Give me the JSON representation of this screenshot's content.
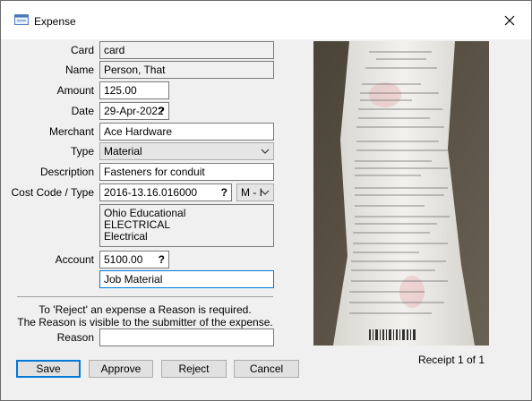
{
  "window": {
    "title": "Expense",
    "close_icon": "close-icon"
  },
  "form": {
    "card_label": "Card",
    "card_value": "card",
    "name_label": "Name",
    "name_value": "Person, That",
    "amount_label": "Amount",
    "amount_value": "125.00",
    "date_label": "Date",
    "date_value": "29-Apr-2022",
    "date_help": "?",
    "merchant_label": "Merchant",
    "merchant_value": "Ace Hardware",
    "type_label": "Type",
    "type_value": "Material",
    "description_label": "Description",
    "description_value": "Fasteners for conduit",
    "costcode_label": "Cost Code / Type",
    "costcode_value": "2016-13.16.016000",
    "costcode_help": "?",
    "costtype_value": "M - I",
    "costcode_details": [
      "Ohio Educational",
      "ELECTRICAL",
      "Electrical"
    ],
    "account_label": "Account",
    "account_value": "5100.00",
    "account_help": "?",
    "account_desc": "Job Material"
  },
  "reject_note": {
    "line1": "To 'Reject' an expense a Reason is required.",
    "line2": "The Reason is visible to the submitter of the expense."
  },
  "reason": {
    "label": "Reason",
    "value": ""
  },
  "buttons": {
    "save": "Save",
    "approve": "Approve",
    "reject": "Reject",
    "cancel": "Cancel"
  },
  "receipt": {
    "caption": "Receipt 1 of 1",
    "image": "receipt-image"
  },
  "colors": {
    "focus_border": "#0078d7",
    "field_border": "#7a7a7a"
  }
}
